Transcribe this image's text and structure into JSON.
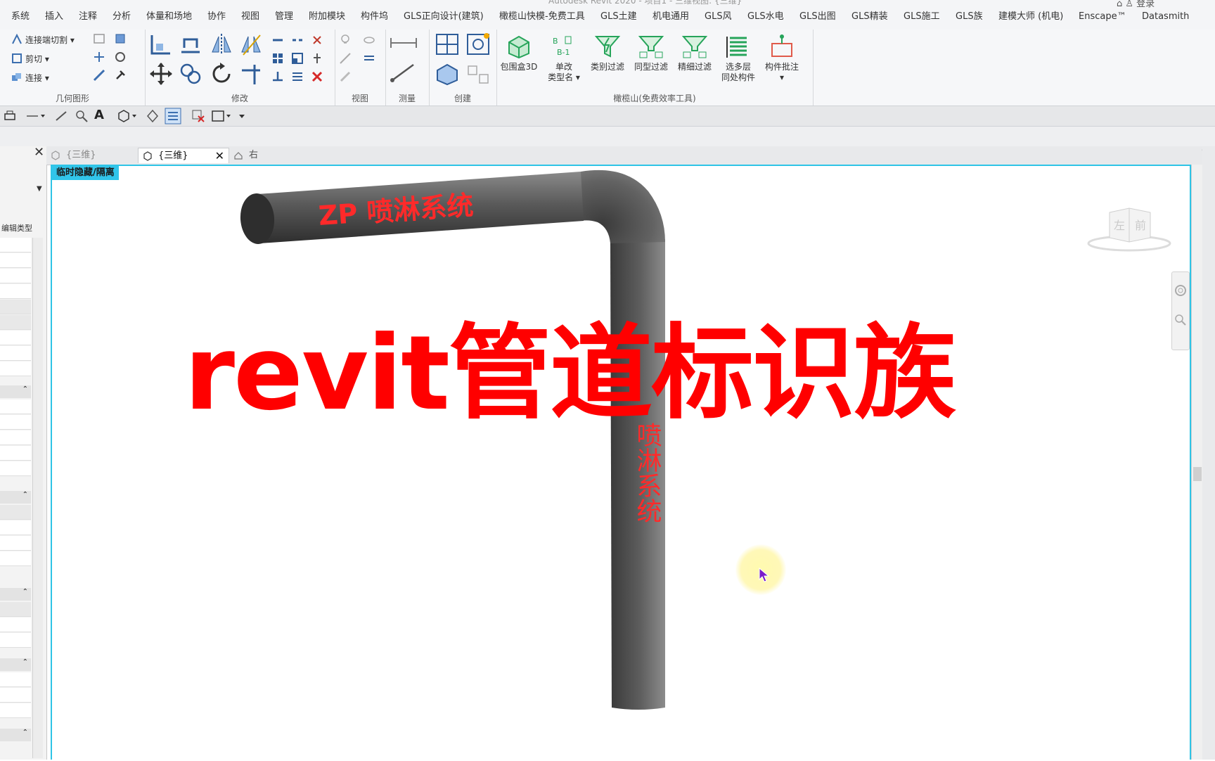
{
  "window": {
    "title_sliver": "Autodesk Revit 2020 - 项目1 - 三维视图: {三维}",
    "user_label": "登录"
  },
  "menu": {
    "tabs": [
      "系统",
      "插入",
      "注释",
      "分析",
      "体量和场地",
      "协作",
      "视图",
      "管理",
      "附加模块",
      "构件坞",
      "GLS正向设计(建筑)",
      "橄榄山快模-免费工具",
      "GLS土建",
      "机电通用",
      "GLS风",
      "GLS水电",
      "GLS出图",
      "GLS精装",
      "GLS施工",
      "GLS族",
      "建模大师 (机电)",
      "Enscape™",
      "Datasmith"
    ]
  },
  "ribbon": {
    "geometry": {
      "title": "几何图形",
      "items": [
        "连接端切割",
        "剪切",
        "连接"
      ]
    },
    "modify": {
      "title": "修改"
    },
    "view": {
      "title": "视图"
    },
    "measure": {
      "title": "测量"
    },
    "create": {
      "title": "创建"
    },
    "olive": {
      "title": "橄榄山(免费效率工具)",
      "buttons": [
        {
          "label": "包围盒3D",
          "icon": "bounding-box-3d-icon"
        },
        {
          "label": "单改\n类型名",
          "icon": "rename-type-icon"
        },
        {
          "label": "类别过滤",
          "icon": "category-filter-icon"
        },
        {
          "label": "同型过滤",
          "icon": "same-type-filter-icon"
        },
        {
          "label": "精细过滤",
          "icon": "fine-filter-icon"
        },
        {
          "label": "选多层\n同处构件",
          "icon": "multi-level-select-icon"
        },
        {
          "label": "构件批注",
          "icon": "component-annotate-icon"
        }
      ]
    }
  },
  "properties_panel": {
    "edit_type_label": "编辑类型"
  },
  "view_tabs": [
    {
      "label": "{三维}",
      "active": false
    },
    {
      "label": "{三维}",
      "active": true
    },
    {
      "label": "右",
      "active": false
    }
  ],
  "canvas": {
    "temp_hide_label": "临时隐藏/隔离",
    "pipe_tag_horizontal": "ZP 喷淋系统",
    "pipe_tag_vertical": "喷淋系统",
    "viewcube_faces": [
      "左",
      "前"
    ]
  },
  "overlay": {
    "title": "revit管道标识族",
    "color": "#ff0000"
  },
  "colors": {
    "canvas_border": "#2ec4e6",
    "pipe_dark": "#3a3a3a",
    "pipe_light": "#8c8c8c",
    "tag_red": "#ff2a2a"
  }
}
